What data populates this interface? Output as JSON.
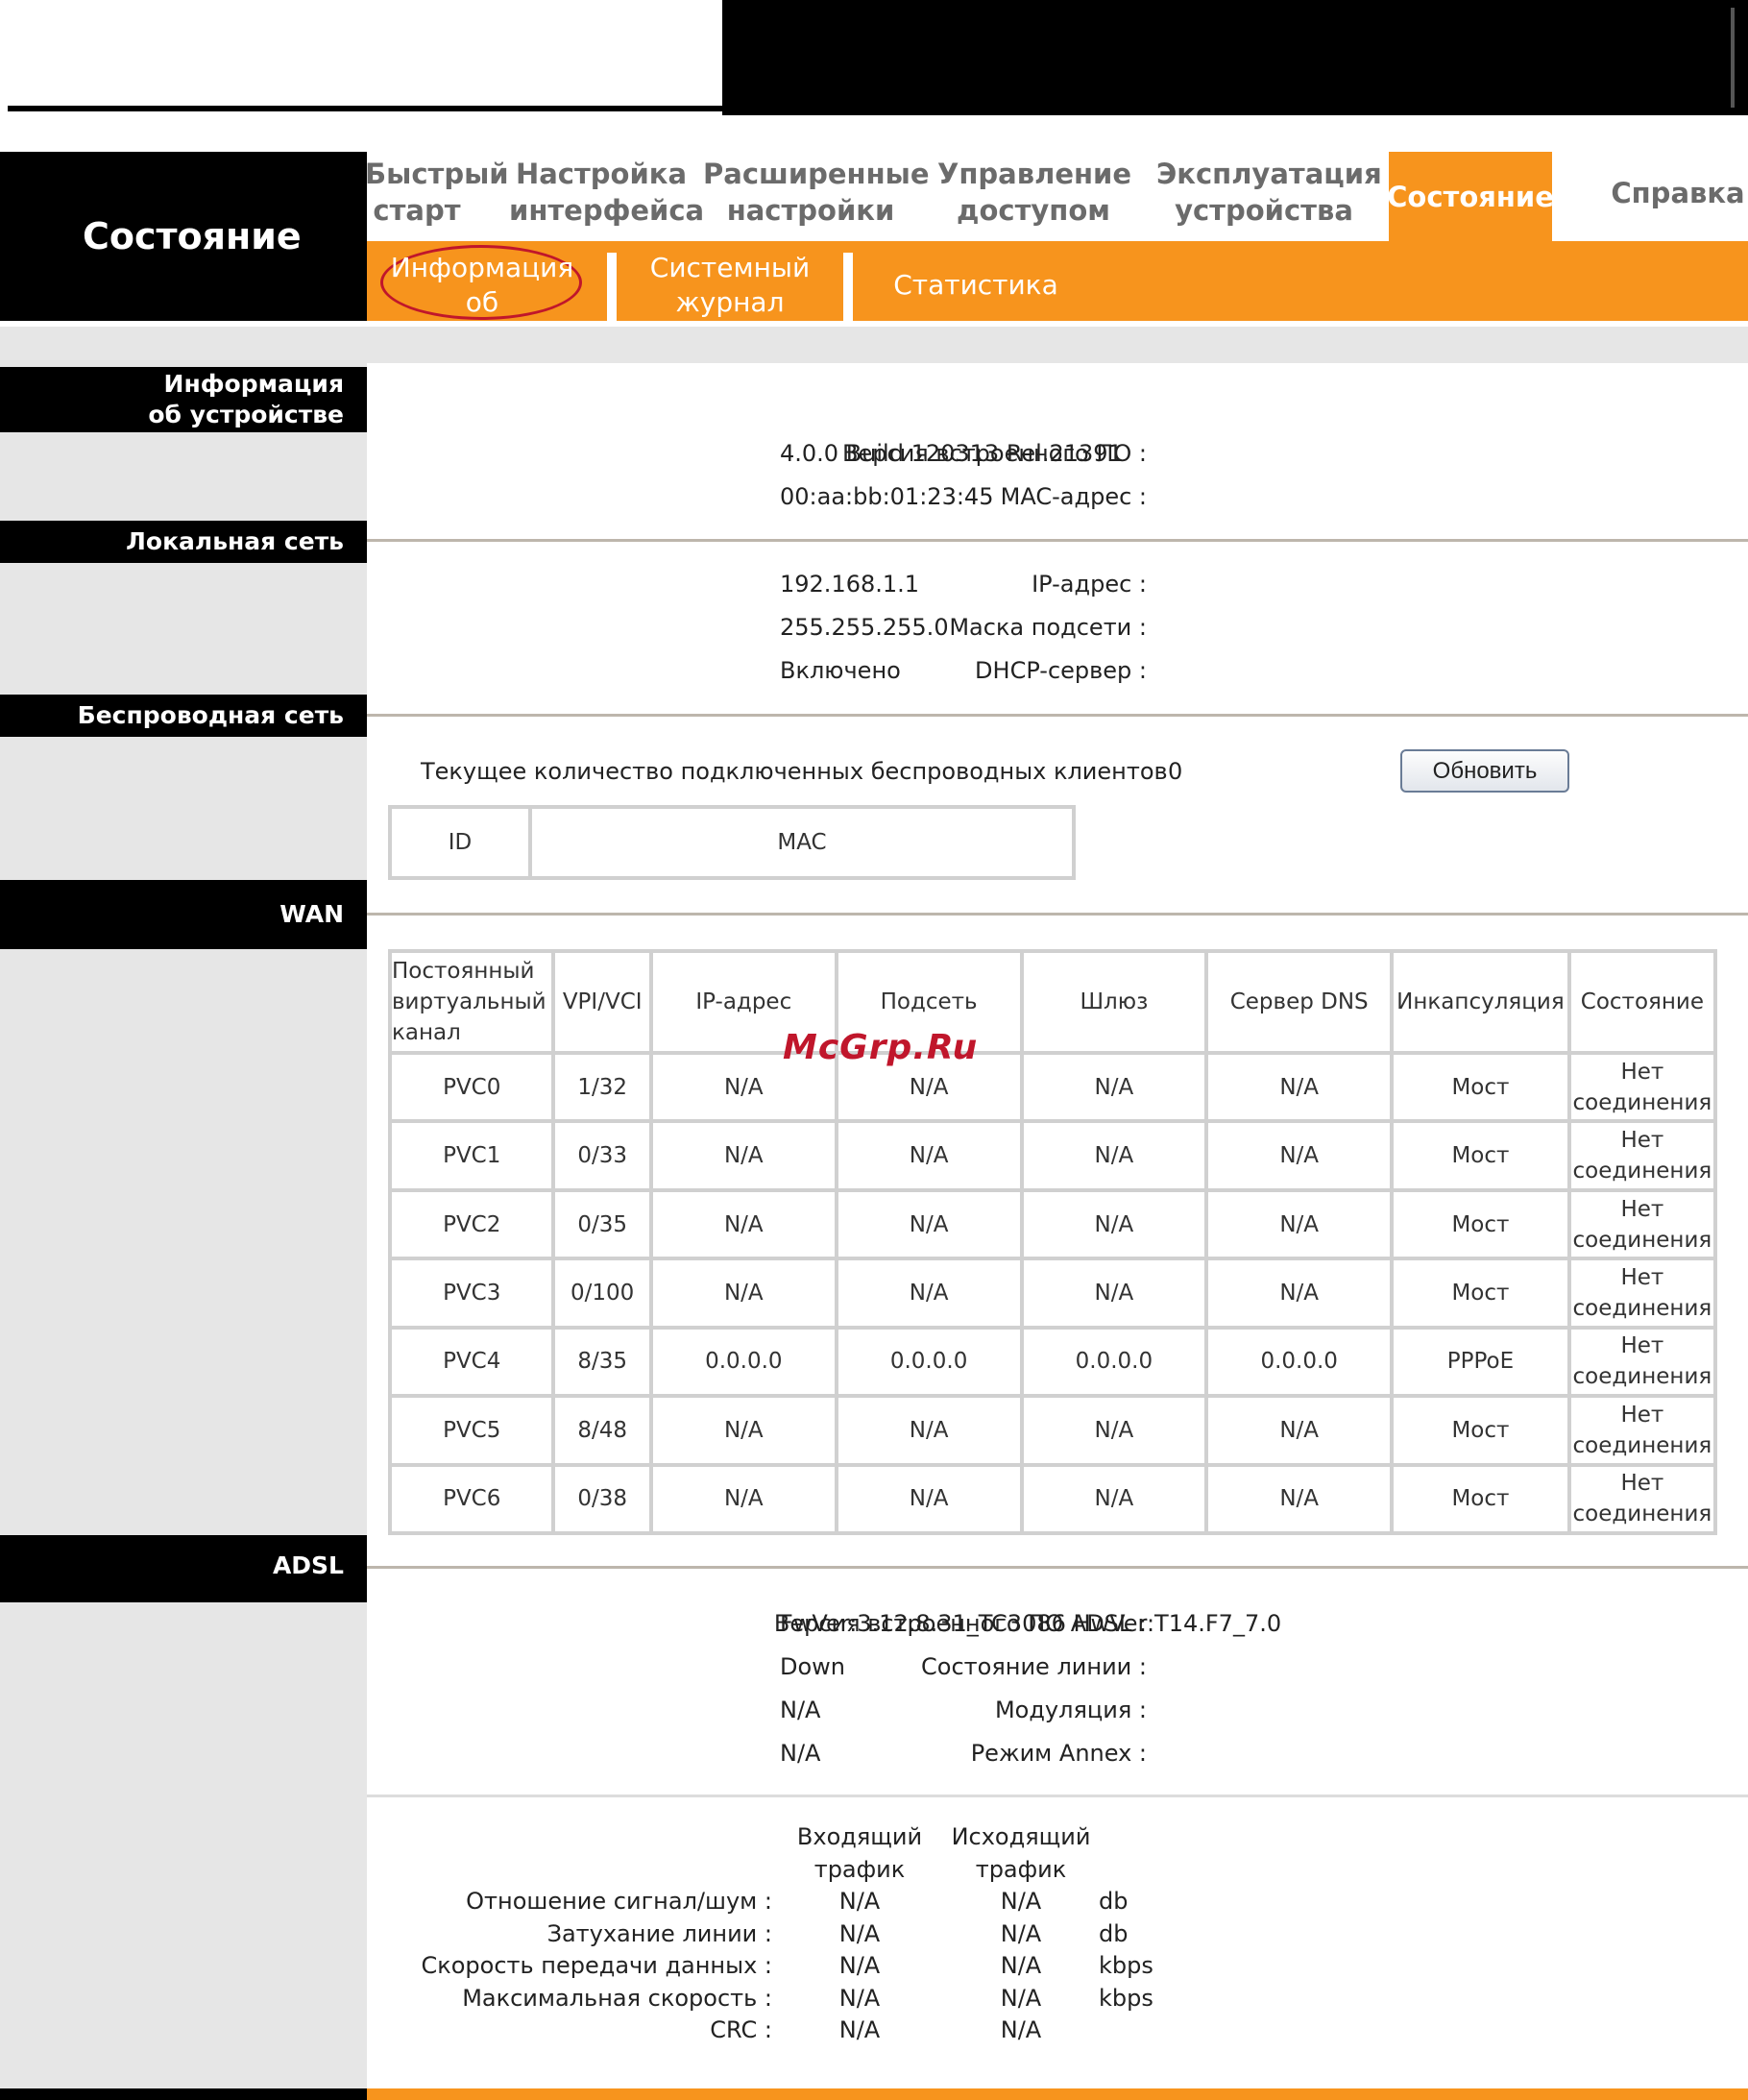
{
  "header": {
    "section_title": "Состояние",
    "main_tabs": [
      {
        "label": "Быстрый\nстарт"
      },
      {
        "label": "Настройка\nинтерфейса"
      },
      {
        "label": "Расширенные\nнастройки"
      },
      {
        "label": "Управление\nдоступом"
      },
      {
        "label": "Эксплуатация\nустройства"
      },
      {
        "label": "Состояние"
      },
      {
        "label": "Справка"
      }
    ],
    "sub_tabs": [
      {
        "label": "Информация\nоб устройстве"
      },
      {
        "label": "Системный\nжурнал"
      },
      {
        "label": "Статистика"
      }
    ]
  },
  "sections": {
    "device_info": {
      "title": "Информация\nоб устройстве",
      "rows": [
        {
          "key": "Версия встроенного ПО :",
          "value": "4.0.0 Build 120313 Rel.21391"
        },
        {
          "key": "MAC-адрес :",
          "value": "00:aa:bb:01:23:45"
        }
      ]
    },
    "lan": {
      "title": "Локальная сеть",
      "rows": [
        {
          "key": "IP-адрес :",
          "value": "192.168.1.1"
        },
        {
          "key": "Маска подсети :",
          "value": "255.255.255.0"
        },
        {
          "key": "DHCP-сервер :",
          "value": "Включено"
        }
      ]
    },
    "wireless": {
      "title": "Беспроводная сеть",
      "clients_label": "Текущее количество подключенных беспроводных клиентов",
      "clients_count": "0",
      "refresh_button": "Обновить",
      "table_headers": [
        "ID",
        "MAC"
      ]
    },
    "wan": {
      "title": "WAN",
      "headers": [
        "Постоянный\nвиртуальный\nканал",
        "VPI/VCI",
        "IP-адрес",
        "Подсеть",
        "Шлюз",
        "Сервер DNS",
        "Инкапсуляция",
        "Состояние"
      ],
      "rows": [
        [
          "PVC0",
          "1/32",
          "N/A",
          "N/A",
          "N/A",
          "N/A",
          "Мост",
          "Нет\nсоединения"
        ],
        [
          "PVC1",
          "0/33",
          "N/A",
          "N/A",
          "N/A",
          "N/A",
          "Мост",
          "Нет\nсоединения"
        ],
        [
          "PVC2",
          "0/35",
          "N/A",
          "N/A",
          "N/A",
          "N/A",
          "Мост",
          "Нет\nсоединения"
        ],
        [
          "PVC3",
          "0/100",
          "N/A",
          "N/A",
          "N/A",
          "N/A",
          "Мост",
          "Нет\nсоединения"
        ],
        [
          "PVC4",
          "8/35",
          "0.0.0.0",
          "0.0.0.0",
          "0.0.0.0",
          "0.0.0.0",
          "PPPoE",
          "Нет\nсоединения"
        ],
        [
          "PVC5",
          "8/48",
          "N/A",
          "N/A",
          "N/A",
          "N/A",
          "Мост",
          "Нет\nсоединения"
        ],
        [
          "PVC6",
          "0/38",
          "N/A",
          "N/A",
          "N/A",
          "N/A",
          "Мост",
          "Нет\nсоединения"
        ]
      ]
    },
    "adsl": {
      "title": "ADSL",
      "rows": [
        {
          "key": "Версия встроенного ПО ADSL :",
          "value": "FwVer:3.12.8.31_TC3086 HwVer:T14.F7_7.0"
        },
        {
          "key": "Состояние линии :",
          "value": "Down"
        },
        {
          "key": "Модуляция :",
          "value": "N/A"
        },
        {
          "key": "Режим Annex :",
          "value": "N/A"
        }
      ],
      "stats_headers": [
        "Входящий\nтрафик",
        "Исходящий\nтрафик"
      ],
      "stats": [
        {
          "label": "Отношение сигнал/шум :",
          "down": "N/A",
          "up": "N/A",
          "unit": "db"
        },
        {
          "label": "Затухание линии :",
          "down": "N/A",
          "up": "N/A",
          "unit": "db"
        },
        {
          "label": "Скорость передачи данных :",
          "down": "N/A",
          "up": "N/A",
          "unit": "kbps"
        },
        {
          "label": "Максимальная скорость :",
          "down": "N/A",
          "up": "N/A",
          "unit": "kbps"
        },
        {
          "label": "CRC :",
          "down": "N/A",
          "up": "N/A",
          "unit": ""
        }
      ]
    }
  },
  "watermark": "McGrp.Ru",
  "colors": {
    "accent": "#f7941d",
    "sidebar": "#e6e6e6",
    "header": "#000000",
    "highlight_circle": "#c0162b"
  }
}
